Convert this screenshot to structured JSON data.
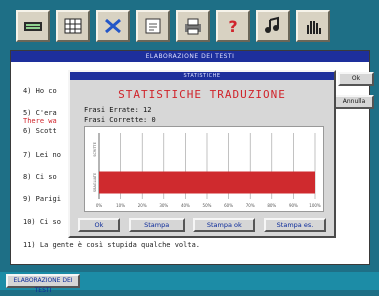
{
  "toolbar": {
    "icons": [
      "keyboard-icon",
      "grid-icon",
      "tools-icon",
      "document-icon",
      "printer-icon",
      "help-icon",
      "music-icon",
      "hand-icon"
    ]
  },
  "window": {
    "title": "ELABORAZIONE DEI TESTI"
  },
  "text_lines": [
    {
      "id": "l4",
      "text": "4) Ho co"
    },
    {
      "id": "l5",
      "text": "5) C'era"
    },
    {
      "id": "l5b",
      "text": "There wa"
    },
    {
      "id": "l6",
      "text": "6) Scott"
    },
    {
      "id": "l7",
      "text": "7) Lei no"
    },
    {
      "id": "l8",
      "text": "8) Ci so"
    },
    {
      "id": "l9",
      "text": "9) Parigi"
    },
    {
      "id": "l10",
      "text": "10) Ci so"
    },
    {
      "id": "l11",
      "text": "11) La gente è così stupida qualche volta."
    }
  ],
  "side_buttons": {
    "ok": "Ok",
    "annulla": "Annulla"
  },
  "bottom": {
    "tag": "ELABORAZIONE DEI TESTI"
  },
  "dialog": {
    "title": "STATISTICHE",
    "heading": "STATISTICHE TRADUZIONE",
    "errate_label": "Frasi Errate:",
    "errate_value": "12",
    "corrette_label": "Frasi Corrette:",
    "corrette_value": "0",
    "buttons": {
      "ok": "Ok",
      "stampa": "Stampa",
      "stampa_ok": "Stampa ok",
      "stampa_es": "Stampa es."
    }
  },
  "chart_data": {
    "type": "bar",
    "orientation": "horizontal",
    "categories": [
      "SCRITTE",
      "SBAGLIATE"
    ],
    "values": [
      0,
      100
    ],
    "xlim": [
      0,
      100
    ],
    "xticks": [
      "0%",
      "10%",
      "20%",
      "30%",
      "40%",
      "50%",
      "60%",
      "70%",
      "80%",
      "90%",
      "100%"
    ],
    "grid": true,
    "bar_color": "#cf2a2e"
  }
}
